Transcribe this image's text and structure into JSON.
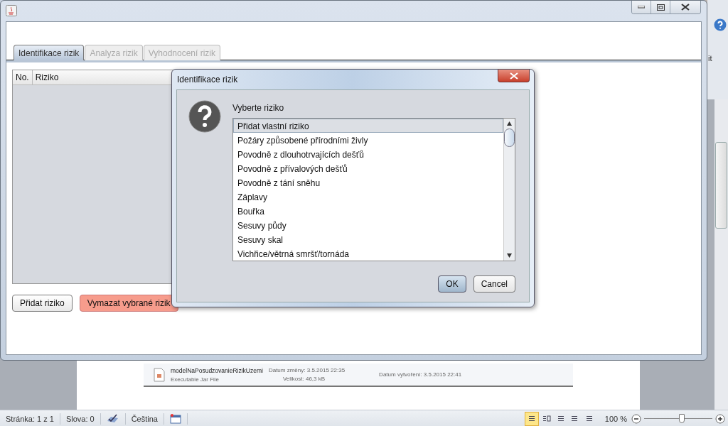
{
  "word": {
    "side_text": "it",
    "file_item": {
      "name": "modelNaPosudzovanieRizikUzemi",
      "type": "Executable Jar File",
      "modified": "Datum změny: 3.5.2015 22:35",
      "size": "Velikost: 46,3 kB",
      "created": "Datum vytvoření: 3.5.2015 22:41"
    },
    "status_bar": {
      "page": "Stránka: 1 z 1",
      "words": "Slova: 0",
      "language": "Čeština",
      "views": [
        {
          "selected": true
        },
        {
          "selected": false
        },
        {
          "selected": false
        },
        {
          "selected": false
        },
        {
          "selected": false
        }
      ],
      "zoom": "100 %",
      "level": 0.55
    }
  },
  "window": {
    "tabs": [
      {
        "label": "Identifikace rizik",
        "selected": true,
        "disabled": false
      },
      {
        "label": "Analyza rizik",
        "selected": false,
        "disabled": true
      },
      {
        "label": "Vyhodnocení rizik",
        "selected": false,
        "disabled": true
      }
    ],
    "table": {
      "columns": [
        "No.",
        "Riziko"
      ]
    },
    "buttons": [
      {
        "label": "Přidat riziko",
        "kind": "normal"
      },
      {
        "label": "Vymazat vybrané rizik",
        "kind": "danger"
      }
    ]
  },
  "dialog": {
    "title": "Identifikace rizik",
    "prompt": "Vyberte riziko",
    "items": [
      {
        "label": "Přidat vlastní riziko",
        "selected": true
      },
      {
        "label": "Požáry způsobené přírodními živly",
        "selected": false
      },
      {
        "label": "Povodně z dlouhotrvajících dešťů",
        "selected": false
      },
      {
        "label": "Povodně z přívalových dešťů",
        "selected": false
      },
      {
        "label": "Povodně z tání sněhu",
        "selected": false
      },
      {
        "label": "Záplavy",
        "selected": false
      },
      {
        "label": "Bouřka",
        "selected": false
      },
      {
        "label": "Sesuvy půdy",
        "selected": false
      },
      {
        "label": "Sesuvy skal",
        "selected": false
      },
      {
        "label": "Vichřice/větrná smršť/tornáda",
        "selected": false
      }
    ],
    "buttons": [
      {
        "label": "OK",
        "kind": "default"
      },
      {
        "label": "Cancel",
        "kind": "normal"
      }
    ]
  }
}
